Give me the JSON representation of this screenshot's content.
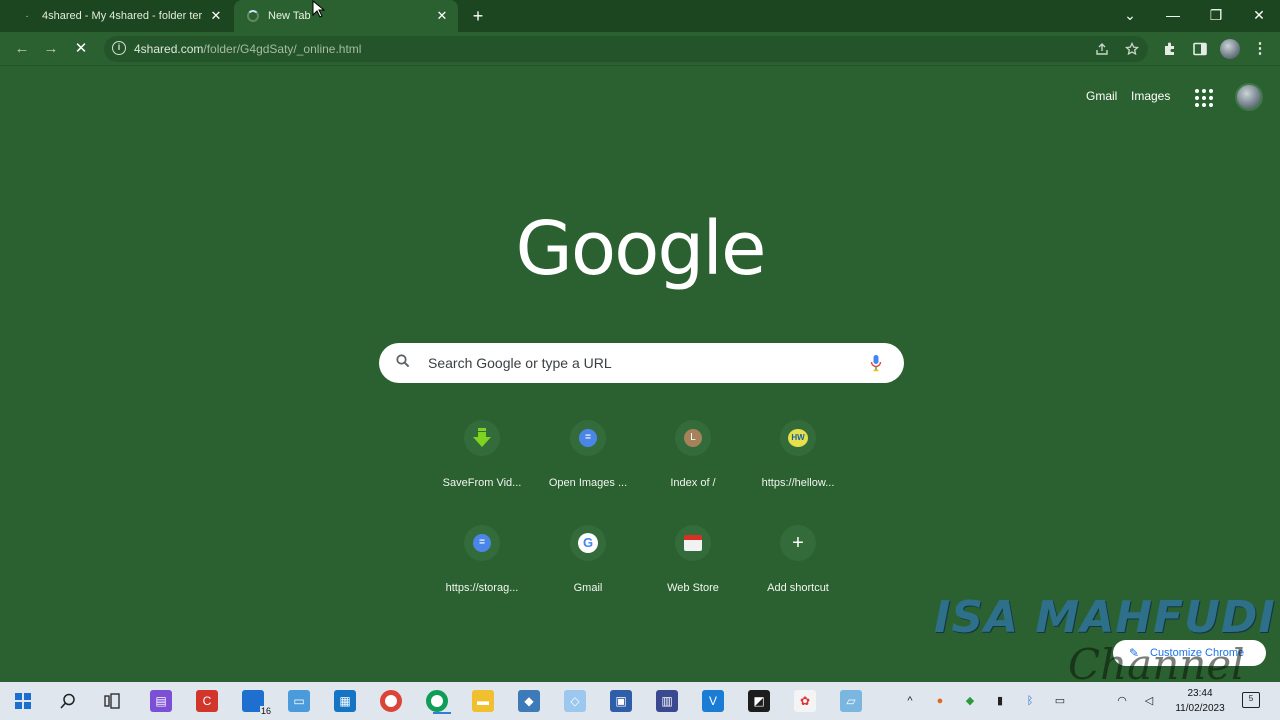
{
  "tabs": [
    {
      "title": "4shared - My 4shared - folder ter",
      "close": "✕"
    },
    {
      "title": "New Tab",
      "close": "✕"
    }
  ],
  "new_tab_label": "+",
  "window_controls": {
    "dropdown": "⌄",
    "minimize": "—",
    "maximize": "❐",
    "close": "✕"
  },
  "toolbar": {
    "url_host": "4shared.com",
    "url_path": "/folder/G4gdSaty/_online.html",
    "info_icon": "i"
  },
  "ntp": {
    "gmail_link": "Gmail",
    "images_link": "Images",
    "logo": "Google",
    "search_placeholder": "Search Google or type a URL",
    "shortcuts": [
      {
        "label": "SaveFrom Vid...",
        "icon": "download-arrow-icon"
      },
      {
        "label": "Open Images ...",
        "icon": "doc-icon",
        "glyph": "="
      },
      {
        "label": "Index of /",
        "icon": "letter-l-icon",
        "glyph": "L"
      },
      {
        "label": "https://hellow...",
        "icon": "hw-icon",
        "glyph": "HW"
      },
      {
        "label": "https://storag...",
        "icon": "doc-icon",
        "glyph": "="
      },
      {
        "label": "Gmail",
        "icon": "google-g-icon",
        "glyph": "G"
      },
      {
        "label": "Web Store",
        "icon": "webstore-icon"
      },
      {
        "label": "Add shortcut",
        "icon": "plus-icon",
        "glyph": "+"
      }
    ],
    "customize_label": "Customize Chrome"
  },
  "watermark": {
    "title": "ISA MAHFUDI",
    "subtitle": "Channel"
  },
  "taskbar": {
    "badge_count": "16",
    "time": "23:44",
    "date": "11/02/2023",
    "notification_count": "5"
  },
  "colors": {
    "page_bg": "#2b6130",
    "tabstrip_bg": "#1c4620",
    "accent_blue": "#1a73e8"
  }
}
